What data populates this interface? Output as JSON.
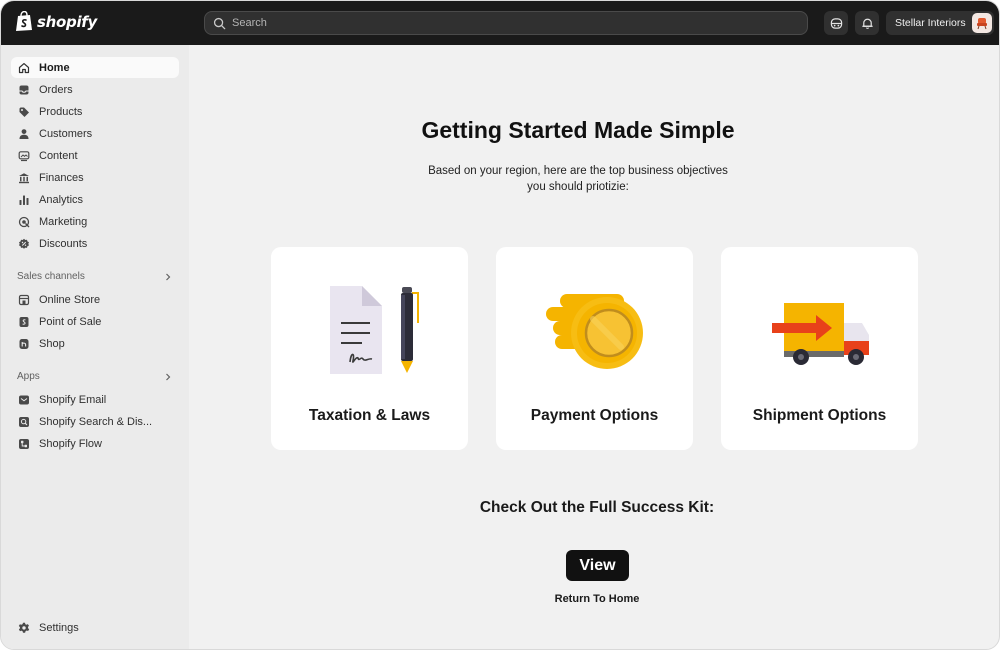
{
  "app": {
    "logo_text": "shopify"
  },
  "topbar": {
    "search_placeholder": "Search",
    "store_name": "Stellar Interiors"
  },
  "sidebar": {
    "items": [
      {
        "label": "Home",
        "icon": "home-icon",
        "active": true
      },
      {
        "label": "Orders",
        "icon": "inbox-icon"
      },
      {
        "label": "Products",
        "icon": "tag-icon"
      },
      {
        "label": "Customers",
        "icon": "person-icon"
      },
      {
        "label": "Content",
        "icon": "image-icon"
      },
      {
        "label": "Finances",
        "icon": "bank-icon"
      },
      {
        "label": "Analytics",
        "icon": "bar-chart-icon"
      },
      {
        "label": "Marketing",
        "icon": "target-icon"
      },
      {
        "label": "Discounts",
        "icon": "discount-icon"
      }
    ],
    "sales_channels_label": "Sales channels",
    "sales_channels": [
      {
        "label": "Online Store",
        "icon": "store-icon"
      },
      {
        "label": "Point of Sale",
        "icon": "pos-icon"
      },
      {
        "label": "Shop",
        "icon": "shop-icon"
      }
    ],
    "apps_label": "Apps",
    "apps": [
      {
        "label": "Shopify Email",
        "icon": "email-icon"
      },
      {
        "label": "Shopify Search & Dis...",
        "icon": "search-app-icon"
      },
      {
        "label": "Shopify Flow",
        "icon": "flow-icon"
      }
    ],
    "settings_label": "Settings"
  },
  "main": {
    "title": "Getting Started Made Simple",
    "subtitle": "Based on your region, here are the top business objectives you should priotizie:",
    "cards": [
      {
        "label": "Taxation & Laws",
        "icon": "document-pen-icon"
      },
      {
        "label": "Payment Options",
        "icon": "coin-icon"
      },
      {
        "label": "Shipment Options",
        "icon": "delivery-truck-icon"
      }
    ],
    "kit_heading": "Check Out the Full Success Kit:",
    "view_label": "View",
    "return_label": "Return To Home"
  },
  "colors": {
    "topbar": "#1a1a1a",
    "sidebar": "#ebebeb",
    "main_bg": "#f1f1f1",
    "coin": "#f5b400",
    "truck_orange": "#e8411a"
  }
}
